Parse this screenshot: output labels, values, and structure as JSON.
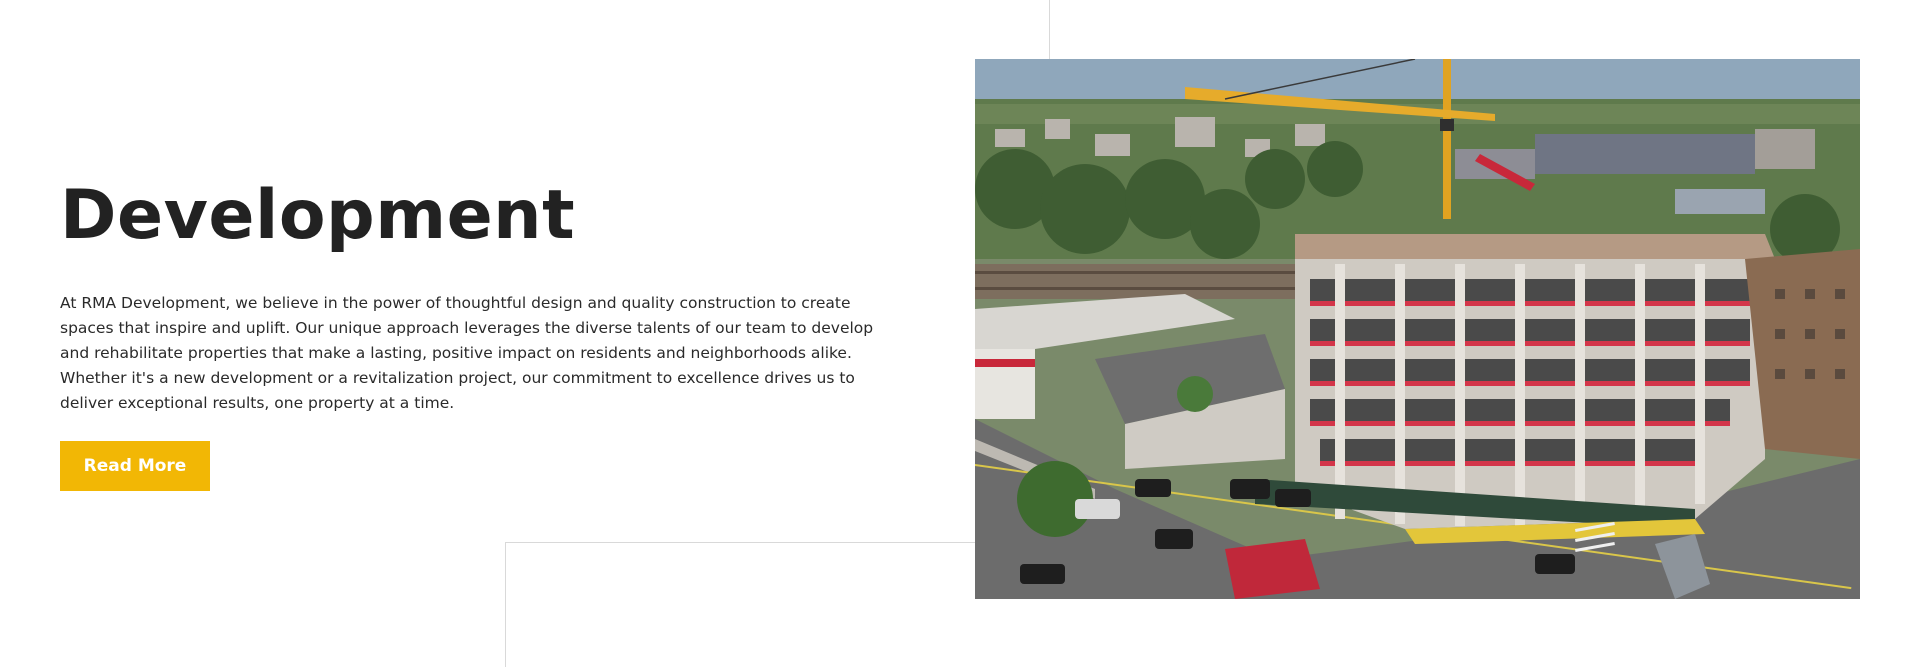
{
  "hero": {
    "title": "Development",
    "description": "At RMA Development, we believe in the power of thoughtful design and quality construction to create spaces that inspire and uplift. Our unique approach leverages the diverse talents of our team to develop and rehabilitate properties that make a lasting, positive impact on residents and neighborhoods alike. Whether it's a new development or a revitalization project, our commitment to excellence drives us to deliver exceptional results, one property at a time.",
    "button_label": "Read More"
  },
  "photo": {
    "subject": "aerial-construction-site"
  },
  "colors": {
    "accent": "#f2b705",
    "heading": "#222222",
    "text": "#2a2a2a",
    "divider": "#d9d9d9"
  }
}
